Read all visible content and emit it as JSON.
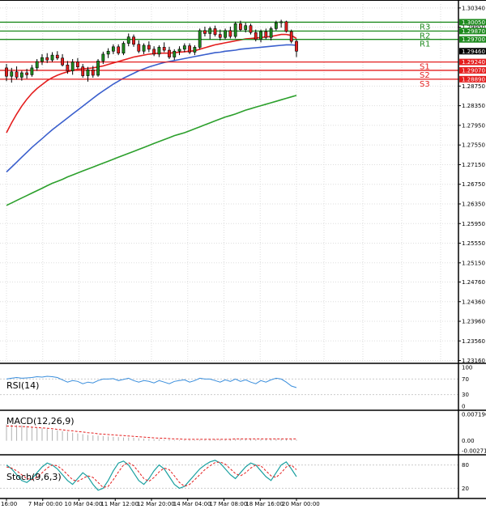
{
  "chart_data": {
    "type": "candlestick",
    "levels": [
      {
        "name": "R3",
        "value": 1.3005,
        "tag": "1.30050",
        "color": "#1e8a1e"
      },
      {
        "name": "R2",
        "value": 1.2987,
        "tag": "1.29870",
        "color": "#1e8a1e"
      },
      {
        "name": "R1",
        "value": 1.297,
        "tag": "1.29700",
        "color": "#1e8a1e"
      },
      {
        "name": "S1",
        "value": 1.2924,
        "tag": "1.29240",
        "color": "#e41e1e"
      },
      {
        "name": "S2",
        "value": 1.2907,
        "tag": "1.29070",
        "color": "#e41e1e"
      },
      {
        "name": "S3",
        "value": 1.2889,
        "tag": "1.28890",
        "color": "#e41e1e"
      }
    ],
    "current_price": {
      "value": 1.2946,
      "tag": "1.29460"
    },
    "price_axis": {
      "ylim": [
        1.2312,
        1.3042
      ],
      "ticks": [
        "1.30340",
        "1.29950",
        "1.28750",
        "1.28350",
        "1.27950",
        "1.27550",
        "1.27150",
        "1.26750",
        "1.26350",
        "1.25950",
        "1.25550",
        "1.25150",
        "1.24760",
        "1.24360",
        "1.23960",
        "1.23560",
        "1.23160"
      ]
    },
    "x_ticks": [
      "16:00",
      "7 Mar 00:00",
      "10 Mar 04:00",
      "11 Mar 12:00",
      "12 Mar 20:00",
      "14 Mar 04:00",
      "17 Mar 08:00",
      "18 Mar 16:00",
      "20 Mar 00:00"
    ],
    "candles": [
      [
        1.2912,
        1.292,
        1.2885,
        1.2895
      ],
      [
        1.2895,
        1.2912,
        1.2882,
        1.2904
      ],
      [
        1.2904,
        1.2915,
        1.2888,
        1.2893
      ],
      [
        1.2893,
        1.2906,
        1.2886,
        1.2902
      ],
      [
        1.2902,
        1.291,
        1.289,
        1.2898
      ],
      [
        1.2898,
        1.2918,
        1.2894,
        1.2912
      ],
      [
        1.2912,
        1.293,
        1.2906,
        1.2925
      ],
      [
        1.2925,
        1.294,
        1.2918,
        1.2933
      ],
      [
        1.2933,
        1.2942,
        1.2922,
        1.2928
      ],
      [
        1.2928,
        1.2944,
        1.2924,
        1.2938
      ],
      [
        1.2938,
        1.2946,
        1.2928,
        1.2932
      ],
      [
        1.2932,
        1.294,
        1.2915,
        1.2918
      ],
      [
        1.2918,
        1.2926,
        1.29,
        1.2906
      ],
      [
        1.2906,
        1.293,
        1.2898,
        1.2924
      ],
      [
        1.2924,
        1.2932,
        1.291,
        1.2914
      ],
      [
        1.2914,
        1.292,
        1.2892,
        1.2896
      ],
      [
        1.2896,
        1.2914,
        1.2884,
        1.2908
      ],
      [
        1.2908,
        1.2916,
        1.2892,
        1.2897
      ],
      [
        1.2897,
        1.293,
        1.2894,
        1.2926
      ],
      [
        1.2926,
        1.2945,
        1.292,
        1.294
      ],
      [
        1.294,
        1.2952,
        1.2932,
        1.2946
      ],
      [
        1.2946,
        1.296,
        1.294,
        1.2955
      ],
      [
        1.2955,
        1.296,
        1.2938,
        1.2942
      ],
      [
        1.2942,
        1.2966,
        1.2938,
        1.2962
      ],
      [
        1.2962,
        1.2982,
        1.2956,
        1.2975
      ],
      [
        1.2975,
        1.298,
        1.2955,
        1.296
      ],
      [
        1.296,
        1.2968,
        1.2942,
        1.2946
      ],
      [
        1.2946,
        1.2962,
        1.294,
        1.2958
      ],
      [
        1.2958,
        1.2966,
        1.2944,
        1.295
      ],
      [
        1.295,
        1.2956,
        1.2936,
        1.294
      ],
      [
        1.294,
        1.2958,
        1.2934,
        1.2954
      ],
      [
        1.2954,
        1.2964,
        1.2944,
        1.2948
      ],
      [
        1.2948,
        1.2955,
        1.293,
        1.2934
      ],
      [
        1.2934,
        1.295,
        1.2928,
        1.2946
      ],
      [
        1.2946,
        1.2956,
        1.2938,
        1.295
      ],
      [
        1.295,
        1.2962,
        1.2944,
        1.2957
      ],
      [
        1.2957,
        1.2962,
        1.294,
        1.2944
      ],
      [
        1.2944,
        1.2958,
        1.2938,
        1.2954
      ],
      [
        1.2954,
        1.2992,
        1.295,
        1.2988
      ],
      [
        1.2988,
        1.2996,
        1.2976,
        1.2982
      ],
      [
        1.2982,
        1.2996,
        1.297,
        1.2992
      ],
      [
        1.2992,
        1.2998,
        1.2976,
        1.298
      ],
      [
        1.298,
        1.299,
        1.2968,
        1.2974
      ],
      [
        1.2974,
        1.2992,
        1.297,
        1.2988
      ],
      [
        1.2988,
        1.2996,
        1.2972,
        1.2976
      ],
      [
        1.2976,
        1.3006,
        1.2972,
        1.3002
      ],
      [
        1.3002,
        1.3008,
        1.2986,
        1.299
      ],
      [
        1.299,
        1.3004,
        1.2984,
        1.2998
      ],
      [
        1.2998,
        1.3002,
        1.298,
        1.2984
      ],
      [
        1.2984,
        1.299,
        1.2966,
        1.297
      ],
      [
        1.297,
        1.299,
        1.2964,
        1.2986
      ],
      [
        1.2986,
        1.2992,
        1.297,
        1.2974
      ],
      [
        1.2974,
        1.2996,
        1.2968,
        1.2992
      ],
      [
        1.2992,
        1.3008,
        1.2988,
        1.3004
      ],
      [
        1.3004,
        1.301,
        1.2994,
        1.3006
      ],
      [
        1.3006,
        1.3008,
        1.2984,
        1.2986
      ],
      [
        1.2986,
        1.299,
        1.2962,
        1.2966
      ],
      [
        1.2966,
        1.297,
        1.2934,
        1.2946
      ]
    ],
    "ma_red": {
      "color": "#e41e1e",
      "values": [
        1.278,
        1.28,
        1.2818,
        1.2834,
        1.2848,
        1.286,
        1.287,
        1.2878,
        1.2886,
        1.2892,
        1.2897,
        1.2901,
        1.2904,
        1.2907,
        1.2909,
        1.291,
        1.2911,
        1.2912,
        1.2914,
        1.2916,
        1.2919,
        1.2922,
        1.2925,
        1.2928,
        1.2931,
        1.2934,
        1.2936,
        1.2938,
        1.294,
        1.2941,
        1.2942,
        1.2942,
        1.2942,
        1.2943,
        1.2944,
        1.2945,
        1.2946,
        1.2947,
        1.295,
        1.2953,
        1.2956,
        1.2959,
        1.2961,
        1.2963,
        1.2965,
        1.2967,
        1.2969,
        1.2971,
        1.2972,
        1.2973,
        1.2974,
        1.2975,
        1.2976,
        1.2978,
        1.298,
        1.298,
        1.2978,
        1.2972
      ]
    },
    "ma_blue": {
      "color": "#3a5fcd",
      "values": [
        1.27,
        1.271,
        1.272,
        1.273,
        1.274,
        1.275,
        1.2759,
        1.2768,
        1.2777,
        1.2786,
        1.2794,
        1.2802,
        1.281,
        1.2818,
        1.2826,
        1.2834,
        1.2842,
        1.285,
        1.2858,
        1.2865,
        1.2872,
        1.2879,
        1.2885,
        1.2891,
        1.2896,
        1.2901,
        1.2906,
        1.291,
        1.2914,
        1.2917,
        1.292,
        1.2923,
        1.2925,
        1.2927,
        1.2929,
        1.2931,
        1.2933,
        1.2935,
        1.2937,
        1.2939,
        1.2941,
        1.2943,
        1.2944,
        1.2946,
        1.2947,
        1.2948,
        1.295,
        1.2951,
        1.2952,
        1.2953,
        1.2954,
        1.2955,
        1.2956,
        1.2957,
        1.2958,
        1.2959,
        1.2959,
        1.2958
      ]
    },
    "ma_green": {
      "color": "#2ca02c",
      "values": [
        1.2632,
        1.2637,
        1.2642,
        1.2647,
        1.2652,
        1.2657,
        1.2662,
        1.2667,
        1.2672,
        1.2677,
        1.2681,
        1.2685,
        1.269,
        1.2694,
        1.2698,
        1.2702,
        1.2706,
        1.271,
        1.2714,
        1.2718,
        1.2722,
        1.2726,
        1.273,
        1.2734,
        1.2738,
        1.2742,
        1.2746,
        1.275,
        1.2754,
        1.2758,
        1.2762,
        1.2766,
        1.277,
        1.2774,
        1.2777,
        1.278,
        1.2784,
        1.2788,
        1.2792,
        1.2796,
        1.28,
        1.2804,
        1.2808,
        1.2812,
        1.2815,
        1.2818,
        1.2822,
        1.2826,
        1.2829,
        1.2832,
        1.2835,
        1.2838,
        1.2841,
        1.2844,
        1.2847,
        1.285,
        1.2853,
        1.2856
      ]
    },
    "rsi": {
      "label": "RSI(14)",
      "ticks": [
        "100",
        "70",
        "30",
        "0"
      ],
      "ylim": [
        0,
        100
      ],
      "color": "#3a8edc",
      "values": [
        70,
        72,
        74,
        72,
        73,
        74,
        76,
        75,
        77,
        76,
        74,
        68,
        62,
        66,
        64,
        58,
        62,
        60,
        66,
        70,
        70,
        71,
        66,
        69,
        72,
        66,
        62,
        66,
        64,
        60,
        66,
        62,
        58,
        64,
        66,
        68,
        62,
        66,
        72,
        70,
        70,
        66,
        62,
        68,
        64,
        70,
        64,
        68,
        62,
        58,
        66,
        62,
        68,
        72,
        70,
        62,
        52,
        48
      ]
    },
    "macd": {
      "label": "MACD(12,26,9)",
      "ticks": [
        "0.007196",
        "0.00",
        "-0.002711"
      ],
      "ylim": [
        -0.002711,
        0.007196
      ],
      "hist_color": "#b0b0b0",
      "signal_color": "#e41e1e",
      "histogram": [
        0.0045,
        0.0044,
        0.0043,
        0.0042,
        0.004,
        0.0038,
        0.0036,
        0.0034,
        0.0032,
        0.003,
        0.0028,
        0.0026,
        0.0024,
        0.0022,
        0.002,
        0.0018,
        0.0016,
        0.0015,
        0.0014,
        0.0013,
        0.0012,
        0.0011,
        0.001,
        0.0009,
        0.0009,
        0.0008,
        0.0007,
        0.0006,
        0.0005,
        0.0004,
        0.0004,
        0.0003,
        0.0003,
        0.0002,
        0.0002,
        0.0002,
        0.0002,
        0.0002,
        0.0003,
        0.0003,
        0.0004,
        0.0004,
        0.0004,
        0.0004,
        0.0005,
        0.0005,
        0.0005,
        0.0005,
        0.0005,
        0.0004,
        0.0004,
        0.0004,
        0.0004,
        0.0005,
        0.0005,
        0.0005,
        0.0004,
        0.0003
      ],
      "signal": [
        0.004,
        0.004,
        0.0039,
        0.0039,
        0.0038,
        0.0037,
        0.0036,
        0.0035,
        0.0034,
        0.0033,
        0.0031,
        0.003,
        0.0028,
        0.0027,
        0.0025,
        0.0024,
        0.0022,
        0.0021,
        0.0019,
        0.0018,
        0.0017,
        0.0016,
        0.0015,
        0.0014,
        0.0013,
        0.0012,
        0.0011,
        0.001,
        0.0009,
        0.0008,
        0.0007,
        0.0007,
        0.0006,
        0.0005,
        0.0005,
        0.0004,
        0.0004,
        0.0004,
        0.0004,
        0.0004,
        0.0004,
        0.0004,
        0.0004,
        0.0004,
        0.0004,
        0.0005,
        0.0005,
        0.0005,
        0.0005,
        0.0005,
        0.0005,
        0.0005,
        0.0005,
        0.0005,
        0.0005,
        0.0005,
        0.0005,
        0.0005
      ]
    },
    "stoch": {
      "label": "Stoch(9,6,3)",
      "ticks": [
        "80",
        "20"
      ],
      "ylim": [
        0,
        100
      ],
      "k_color": "#1aa0a0",
      "d_color": "#e41e1e",
      "k": [
        80,
        70,
        55,
        40,
        35,
        45,
        60,
        75,
        85,
        80,
        70,
        55,
        40,
        30,
        45,
        60,
        50,
        30,
        15,
        20,
        40,
        65,
        85,
        90,
        80,
        60,
        40,
        30,
        45,
        65,
        80,
        70,
        50,
        30,
        20,
        25,
        40,
        55,
        70,
        80,
        88,
        92,
        85,
        70,
        55,
        45,
        60,
        75,
        85,
        80,
        65,
        50,
        40,
        60,
        80,
        88,
        70,
        50
      ],
      "d": [
        75,
        72,
        65,
        55,
        45,
        42,
        48,
        60,
        72,
        80,
        78,
        68,
        55,
        42,
        38,
        45,
        52,
        48,
        35,
        22,
        25,
        42,
        62,
        80,
        86,
        78,
        62,
        45,
        38,
        48,
        62,
        72,
        68,
        52,
        35,
        25,
        30,
        42,
        55,
        68,
        78,
        86,
        88,
        82,
        70,
        58,
        52,
        60,
        72,
        80,
        78,
        65,
        52,
        48,
        60,
        75,
        80,
        68
      ]
    }
  }
}
